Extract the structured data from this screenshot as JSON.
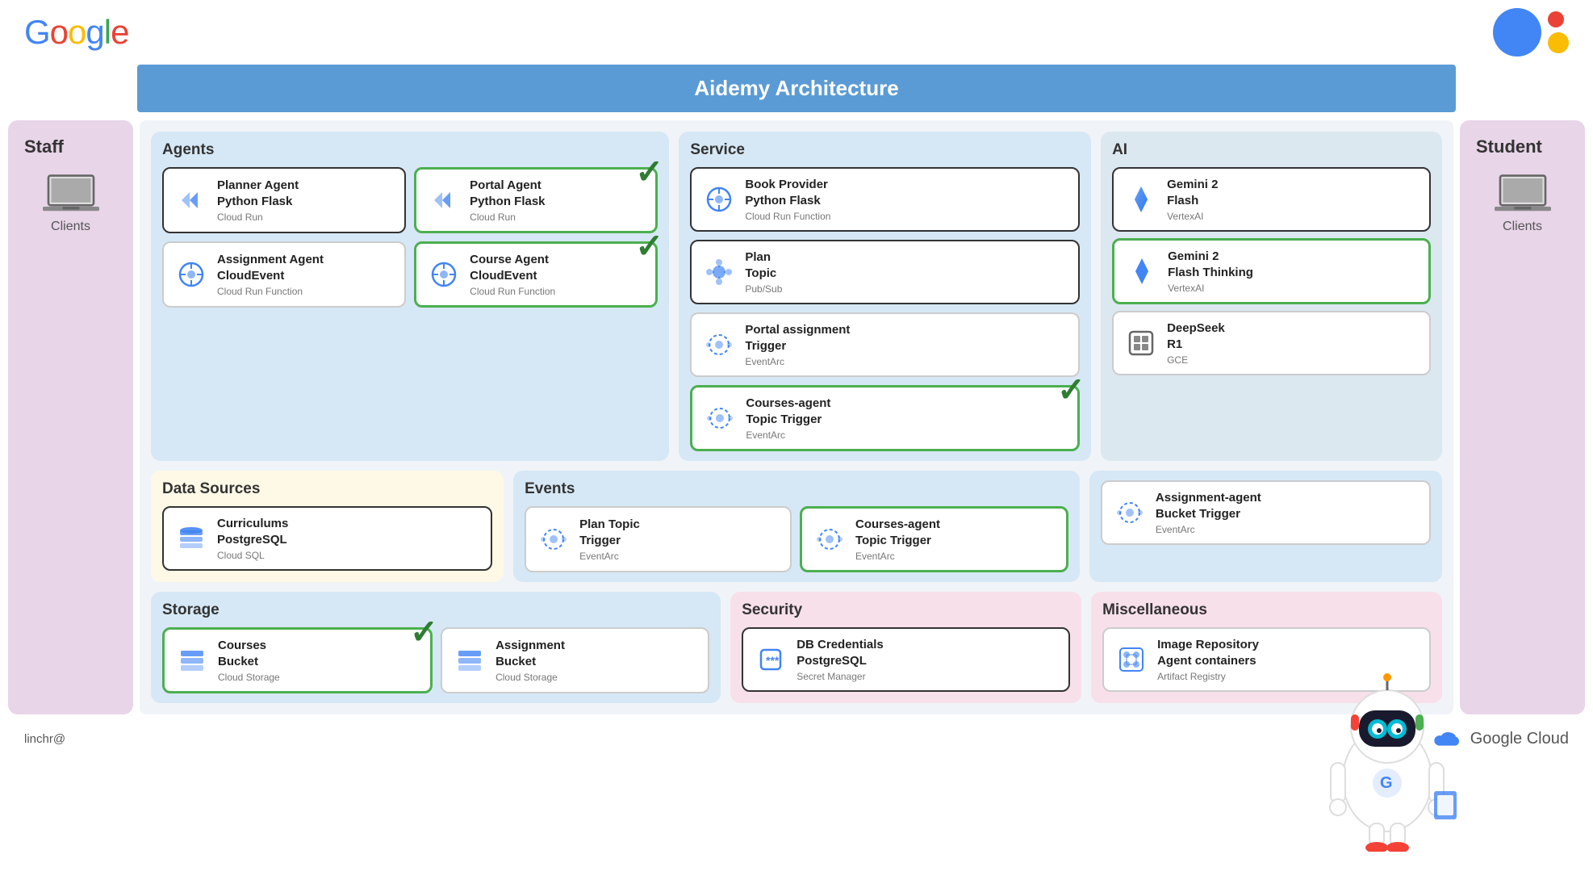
{
  "header": {
    "google_logo": "Google",
    "title": "Aidemy Architecture",
    "email": "linchr@"
  },
  "sidebar_left": {
    "title": "Staff",
    "client_label": "Clients"
  },
  "sidebar_right": {
    "title": "Student",
    "client_label": "Clients"
  },
  "sections": {
    "agents": {
      "title": "Agents",
      "cards": [
        {
          "name": "Planner Agent\nPython Flask",
          "sub": "Cloud Run",
          "border": "dark",
          "checkmark": false,
          "icon": "cloud-run"
        },
        {
          "name": "Portal Agent\nPython Flask",
          "sub": "Cloud Run",
          "border": "green",
          "checkmark": true,
          "icon": "cloud-run"
        },
        {
          "name": "Assignment Agent\nCloudEvent",
          "sub": "Cloud Run Function",
          "border": "normal",
          "checkmark": false,
          "icon": "cloud-function"
        },
        {
          "name": "Course Agent\nCloudEvent",
          "sub": "Cloud Run Function",
          "border": "green",
          "checkmark": true,
          "icon": "cloud-function"
        }
      ]
    },
    "service": {
      "title": "Service",
      "cards": [
        {
          "name": "Book Provider\nPython Flask",
          "sub": "Cloud Run Function",
          "border": "dark",
          "icon": "cloud-function"
        },
        {
          "name": "Plan\nTopic",
          "sub": "Pub/Sub",
          "border": "dark",
          "icon": "pubsub"
        },
        {
          "name": "Portal assignment\nTrigger",
          "sub": "EventArc",
          "border": "normal",
          "icon": "eventarc"
        },
        {
          "name": "Courses-agent\nTopic Trigger",
          "sub": "EventArc",
          "border": "green",
          "checkmark": true,
          "icon": "eventarc"
        }
      ]
    },
    "ai": {
      "title": "AI",
      "cards": [
        {
          "name": "Gemini 2\nFlash",
          "sub": "VertexAI",
          "border": "dark",
          "icon": "gemini"
        },
        {
          "name": "Gemini 2\nFlash Thinking",
          "sub": "VertexAI",
          "border": "green",
          "icon": "gemini"
        },
        {
          "name": "DeepSeek\nR1",
          "sub": "GCE",
          "border": "normal",
          "icon": "deepseek"
        }
      ]
    },
    "datasources": {
      "title": "Data Sources",
      "cards": [
        {
          "name": "Curriculums\nPostgreSQL",
          "sub": "Cloud SQL",
          "border": "dark",
          "icon": "sql"
        }
      ]
    },
    "events": {
      "title": "Events",
      "cards": [
        {
          "name": "Plan Topic\nTrigger",
          "sub": "EventArc",
          "border": "normal",
          "icon": "eventarc"
        },
        {
          "name": "Courses-agent\nTopic Trigger",
          "sub": "EventArc",
          "border": "green",
          "checkmark": false,
          "icon": "eventarc"
        }
      ]
    },
    "assignment_agent": {
      "cards": [
        {
          "name": "Assignment-agent\nBucket Trigger",
          "sub": "EventArc",
          "border": "normal",
          "icon": "eventarc"
        }
      ]
    },
    "storage": {
      "title": "Storage",
      "cards": [
        {
          "name": "Courses\nBucket",
          "sub": "Cloud Storage",
          "border": "green",
          "checkmark": true,
          "icon": "storage"
        },
        {
          "name": "Assignment\nBucket",
          "sub": "Cloud Storage",
          "border": "normal",
          "icon": "storage"
        }
      ]
    },
    "security": {
      "title": "Security",
      "cards": [
        {
          "name": "DB Credentials\nPostgreSQL",
          "sub": "Secret Manager",
          "border": "dark",
          "icon": "secret"
        }
      ]
    },
    "misc": {
      "title": "Miscellaneous",
      "cards": [
        {
          "name": "Image Repository\nAgent containers",
          "sub": "Artifact Registry",
          "border": "normal",
          "icon": "artifact"
        }
      ]
    }
  },
  "bottom": {
    "email": "linchr@",
    "gc_label": "Google Cloud"
  }
}
